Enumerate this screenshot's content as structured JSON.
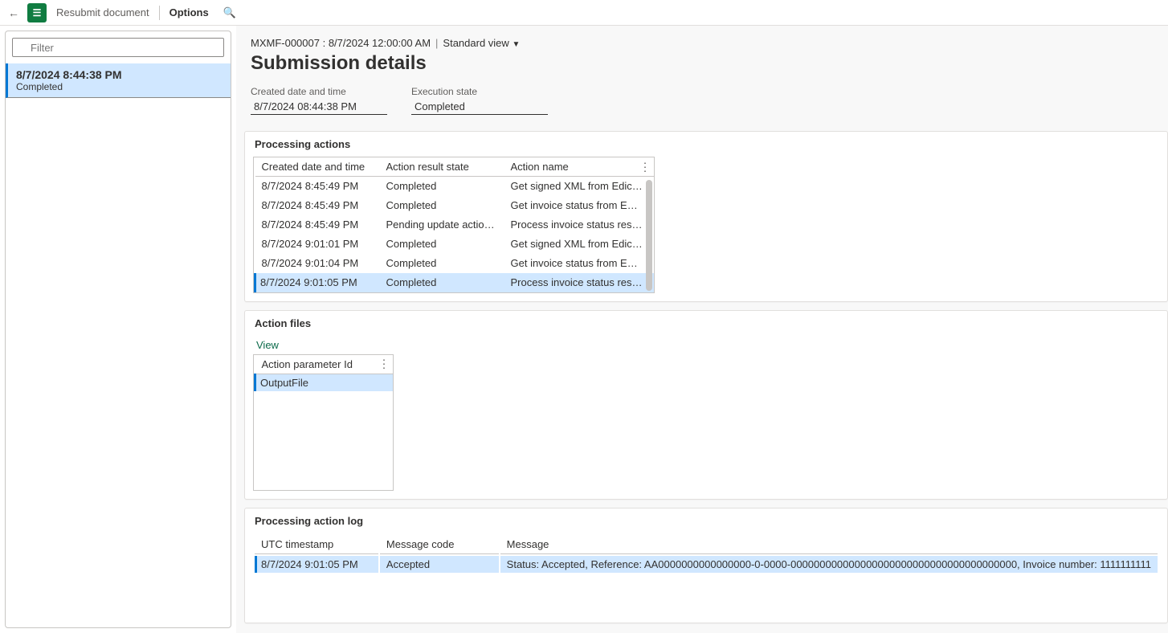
{
  "toolbar": {
    "resubmit": "Resubmit document",
    "options": "Options"
  },
  "sidebar": {
    "filter_placeholder": "Filter",
    "items": [
      {
        "timestamp": "8/7/2024 8:44:38 PM",
        "status": "Completed"
      }
    ]
  },
  "breadcrumb": {
    "doc": "MXMF-000007 : 8/7/2024 12:00:00 AM",
    "view": "Standard view"
  },
  "page_title": "Submission details",
  "fields": {
    "created_label": "Created date and time",
    "created_value": "8/7/2024 08:44:38 PM",
    "state_label": "Execution state",
    "state_value": "Completed"
  },
  "processing_actions": {
    "title": "Processing actions",
    "columns": [
      "Created date and time",
      "Action result state",
      "Action name"
    ],
    "rows": [
      {
        "dt": "8/7/2024 8:45:49 PM",
        "state": "Completed",
        "action": "Get signed XML from Edic…"
      },
      {
        "dt": "8/7/2024 8:45:49 PM",
        "state": "Completed",
        "action": "Get invoice status from E…"
      },
      {
        "dt": "8/7/2024 8:45:49 PM",
        "state": "Pending update actions e…",
        "action": "Process invoice status res…"
      },
      {
        "dt": "8/7/2024 9:01:01 PM",
        "state": "Completed",
        "action": "Get signed XML from Edic…"
      },
      {
        "dt": "8/7/2024 9:01:04 PM",
        "state": "Completed",
        "action": "Get invoice status from E…"
      },
      {
        "dt": "8/7/2024 9:01:05 PM",
        "state": "Completed",
        "action": "Process invoice status res…",
        "selected": true
      }
    ]
  },
  "action_files": {
    "title": "Action files",
    "view": "View",
    "column": "Action parameter Id",
    "rows": [
      {
        "id": "OutputFile",
        "selected": true
      }
    ]
  },
  "action_log": {
    "title": "Processing action log",
    "columns": [
      "UTC timestamp",
      "Message code",
      "Message"
    ],
    "rows": [
      {
        "ts": "8/7/2024 9:01:05 PM",
        "code": "Accepted",
        "msg": "Status: Accepted, Reference: AA0000000000000000-0-0000-000000000000000000000000000000000000000, Invoice number: 1111111111",
        "selected": true
      }
    ]
  }
}
